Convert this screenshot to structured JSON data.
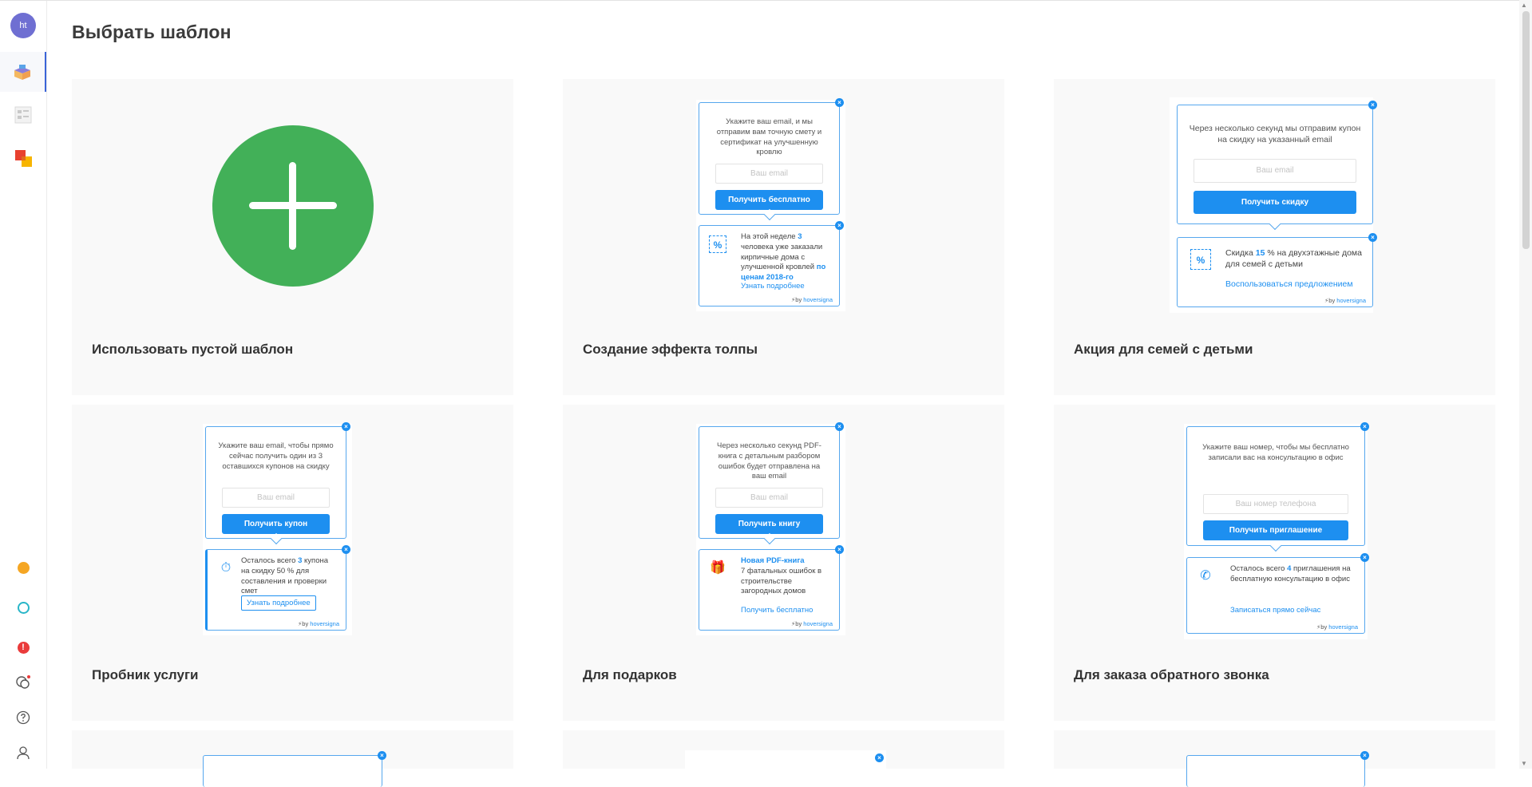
{
  "page": {
    "title": "Выбрать шаблон"
  },
  "sidebar": {
    "avatar_initials": "ht",
    "items": [
      {
        "icon": "box-templates-icon"
      },
      {
        "icon": "list-layout-icon"
      },
      {
        "icon": "color-squares-icon"
      }
    ],
    "bottom": [
      {
        "icon": "orange-circle-icon"
      },
      {
        "icon": "teal-circle-icon"
      },
      {
        "icon": "alert-icon",
        "glyph": "!"
      },
      {
        "icon": "chat-icon"
      },
      {
        "icon": "help-icon"
      },
      {
        "icon": "user-icon"
      }
    ]
  },
  "cards": [
    {
      "title": "Использовать пустой шаблон"
    },
    {
      "title": "Создание эффекта толпы",
      "popup": {
        "text": "Укажите ваш email, и мы отправим вам точную смету и сертификат на улучшенную кровлю",
        "placeholder": "Ваш email",
        "button": "Получить бесплатно"
      },
      "note": {
        "pre": "На этой неделе",
        "num": "3",
        "mid": "человека уже заказали кирпичные дома с улучшенной кровлей",
        "accent": "по ценам 2018-го",
        "link": "Узнать подробнее"
      }
    },
    {
      "title": "Акция для семей с детьми",
      "popup": {
        "text": "Через несколько секунд мы отправим купон на скидку на указанный email",
        "placeholder": "Ваш email",
        "button": "Получить скидку"
      },
      "note": {
        "pre": "Скидка",
        "num": "15",
        "mid": "% на двухэтажные дома для семей с детьми",
        "link": "Воспользоваться предложением"
      }
    },
    {
      "title": "Пробник услуги",
      "popup": {
        "text": "Укажите ваш email, чтобы прямо сейчас получить один из 3 оставшихся купонов на скидку",
        "placeholder": "Ваш email",
        "button": "Получить купон"
      },
      "note": {
        "pre": "Осталось всего",
        "num": "3",
        "mid": "купона на скидку 50 % для составления и проверки смет",
        "link": "Узнать подробнее"
      }
    },
    {
      "title": "Для подарков",
      "popup": {
        "text": "Через несколько секунд PDF-книга с детальным разбором ошибок будет отправлена на ваш email",
        "placeholder": "Ваш email",
        "button": "Получить книгу"
      },
      "note": {
        "accent": "Новая PDF-книга",
        "mid": "7 фатальных ошибок в строительстве загородных домов",
        "link": "Получить бесплатно"
      }
    },
    {
      "title": "Для заказа обратного звонка",
      "popup": {
        "text": "Укажите ваш номер, чтобы мы бесплатно записали вас на консультацию в офис",
        "placeholder": "Ваш номер телефона",
        "button": "Получить приглашение"
      },
      "note": {
        "pre": "Осталось всего",
        "num": "4",
        "mid": "приглашения на бесплатную консультацию в офис",
        "link": "Записаться прямо сейчас"
      }
    }
  ],
  "brand": {
    "by": "by",
    "name": "hoversigna"
  },
  "close_glyph": "×",
  "plus_glyph": "+",
  "colors": {
    "accent": "#1d8ff0",
    "green": "#42b058",
    "card_bg": "#f9f9f9"
  }
}
